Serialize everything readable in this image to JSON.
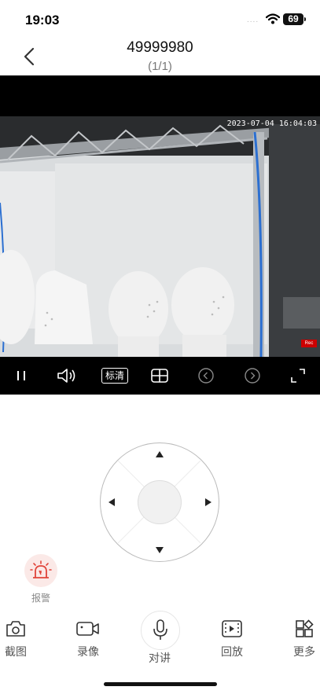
{
  "status_bar": {
    "time": "19:03",
    "signal_dots": "....",
    "battery": "69"
  },
  "header": {
    "title": "49999980",
    "subtitle": "(1/1)"
  },
  "video": {
    "timestamp": "2023-07-04 16:04:03",
    "rec_label": "Rec"
  },
  "controls": {
    "quality_label": "标清"
  },
  "alarm": {
    "label": "报警",
    "color": "#e0443a"
  },
  "toolbar": {
    "screenshot_label": "截图",
    "record_label": "录像",
    "talk_label": "对讲",
    "playback_label": "回放",
    "more_label": "更多"
  }
}
